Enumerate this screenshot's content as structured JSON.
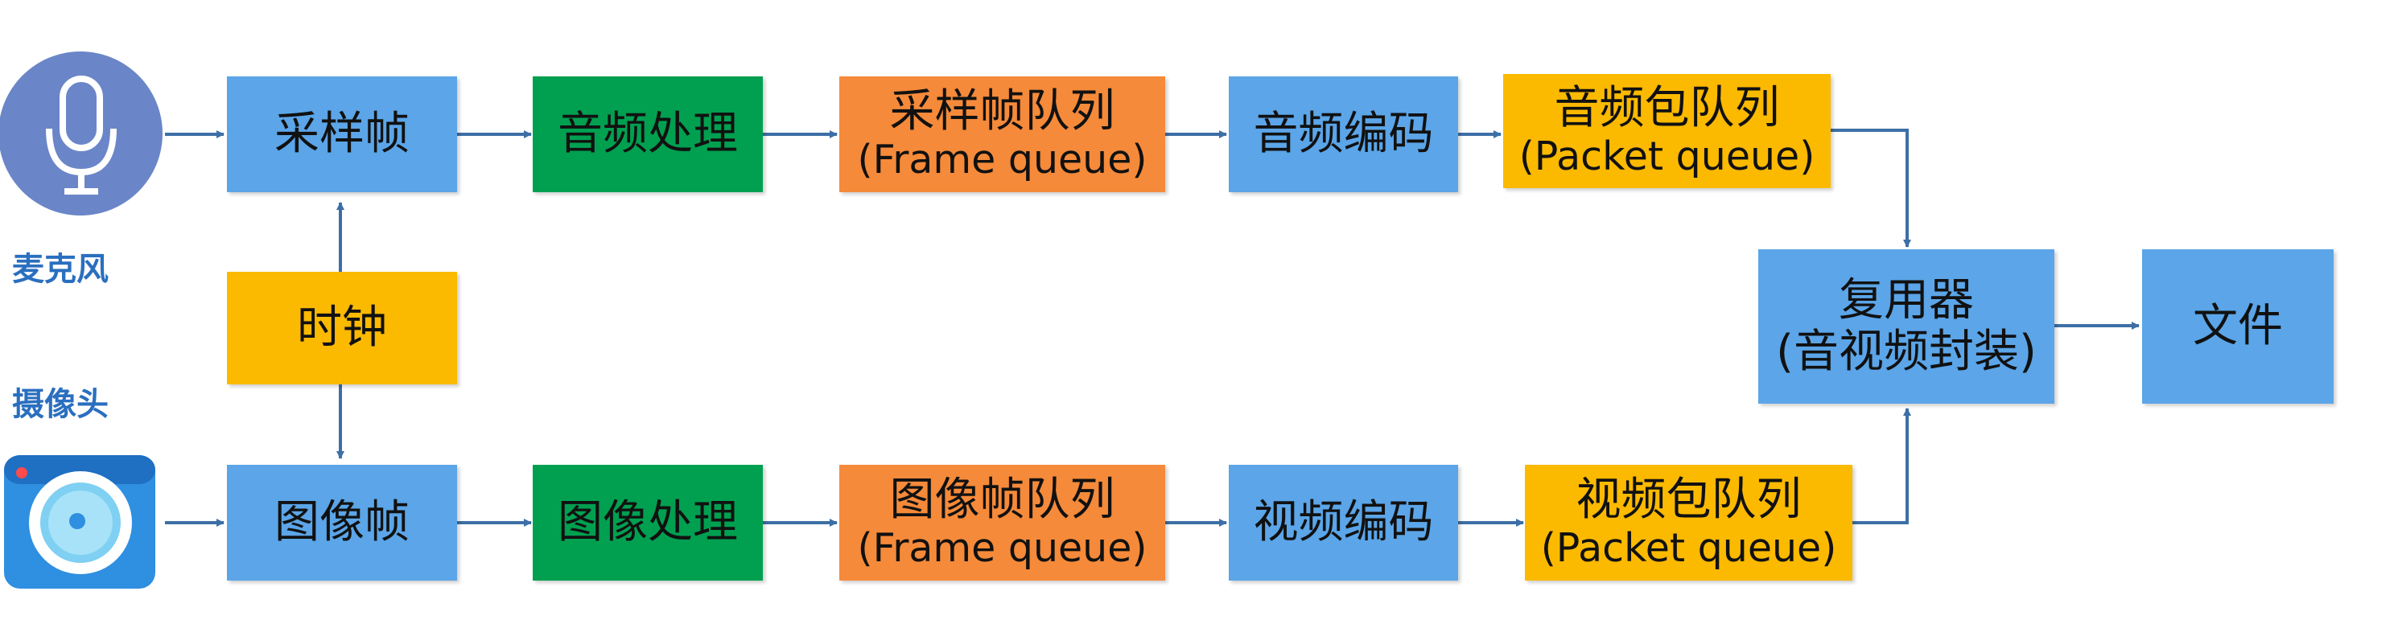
{
  "devices": {
    "microphone": {
      "label": "麦克风",
      "icon": "microphone-icon"
    },
    "camera": {
      "label": "摄像头",
      "icon": "camera-icon"
    }
  },
  "audio_path": {
    "sample_frame": "采样帧",
    "processing": "音频处理",
    "frame_queue": {
      "title": "采样帧队列",
      "subtitle": "(Frame queue)"
    },
    "encoder": "音频编码",
    "packet_queue": {
      "title": "音频包队列",
      "subtitle": "(Packet queue)"
    }
  },
  "clock": "时钟",
  "video_path": {
    "image_frame": "图像帧",
    "processing": "图像处理",
    "frame_queue": {
      "title": "图像帧队列",
      "subtitle": "(Frame queue)"
    },
    "encoder": "视频编码",
    "packet_queue": {
      "title": "视频包队列",
      "subtitle": "(Packet queue)"
    }
  },
  "muxer": {
    "title": "复用器",
    "subtitle": "(音视频封装)"
  },
  "output": "文件",
  "colors": {
    "blue_box": "#5ba5e8",
    "green_box": "#00a050",
    "orange_box": "#f58a3a",
    "yellow_box": "#fbb900",
    "arrow": "#3d6fa6",
    "mic_circle": "#6a86c8",
    "camera_body": "#2f8fe0",
    "label_text": "#2a6fbf"
  }
}
